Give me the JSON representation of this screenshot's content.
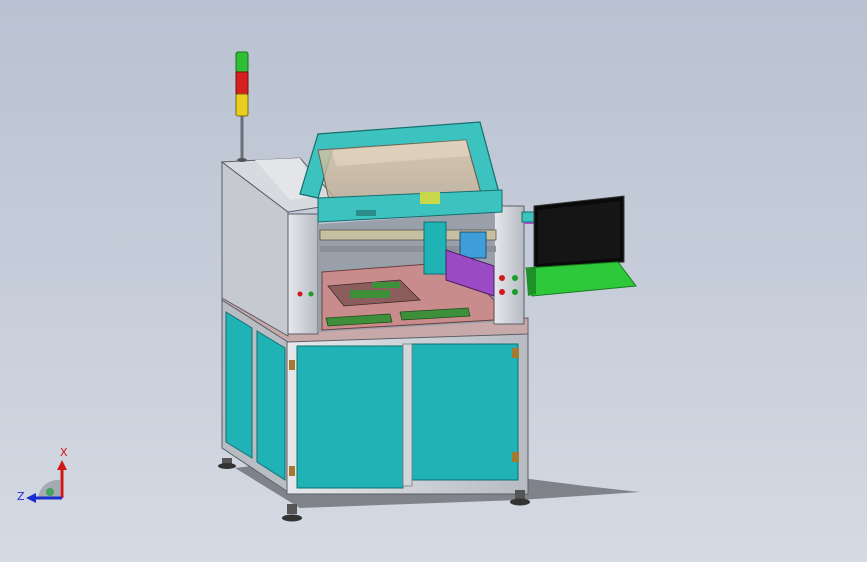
{
  "viewport": {
    "background_top": "#b9c2d2",
    "background_bottom": "#d5dae3"
  },
  "model": {
    "frame_color": "#c9ccd2",
    "panel_color": "#1fb3b6",
    "frame_accent": "#3cc3c0",
    "screen_color": "#0a0a0a",
    "keyboard_color": "#2ec93a",
    "bed_color": "#c98c8c",
    "stack_light": [
      "green",
      "red",
      "yellow"
    ]
  },
  "triad": {
    "x_label": "X",
    "z_label": "Z",
    "x_color": "#d01818",
    "z_color": "#1a2fd0"
  }
}
